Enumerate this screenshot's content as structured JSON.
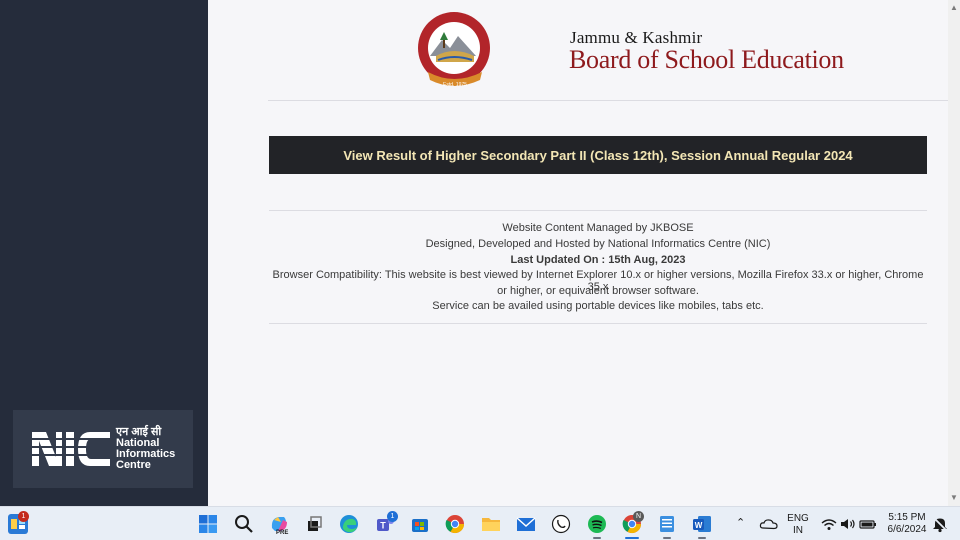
{
  "brand": {
    "subtitle": "Jammu & Kashmir",
    "title": "Board of School Education",
    "logo_ring_text": "Jammu & Kashmir Board Of School Education"
  },
  "result_link": "View Result of Higher Secondary Part II (Class 12th), Session Annual Regular 2024",
  "footer": {
    "managed": "Website Content Managed by JKBOSE",
    "designed": "Designed, Developed and Hosted by National Informatics Centre (NIC)",
    "updated": "Last Updated On : 15th Aug, 2023",
    "compat_1": "Browser Compatibility: This website is best viewed by Internet Explorer 10.x or higher versions, Mozilla Firefox 33.x or higher, Chrome 35.x",
    "compat_2": "or higher, or equivalent browser software.",
    "service": "Service can be availed using portable devices like mobiles, tabs etc."
  },
  "nic": {
    "letters": "NIC",
    "hindi": "एन आई सी",
    "line1": "National",
    "line2": "Informatics",
    "line3": "Centre"
  },
  "taskbar": {
    "widgets_badge": "1",
    "teams_badge": "1",
    "copilot_label": "PRE",
    "chrome_profile": "N",
    "lang_1": "ENG",
    "lang_2": "IN",
    "time": "5:15 PM",
    "date": "6/6/2024",
    "icons": [
      "widgets-icon",
      "windows-start-icon",
      "search-icon",
      "copilot-icon",
      "task-view-icon",
      "edge-icon",
      "teams-icon",
      "store-icon",
      "chrome-icon",
      "file-explorer-icon",
      "mail-icon",
      "whatsapp-icon",
      "spotify-icon",
      "chrome-profile-icon",
      "notepad-icon",
      "word-icon"
    ]
  },
  "colors": {
    "sidebar": "#252c3b",
    "banner": "#222327",
    "banner_text": "#f3e6b5",
    "brand_red": "#8e1a1d"
  }
}
